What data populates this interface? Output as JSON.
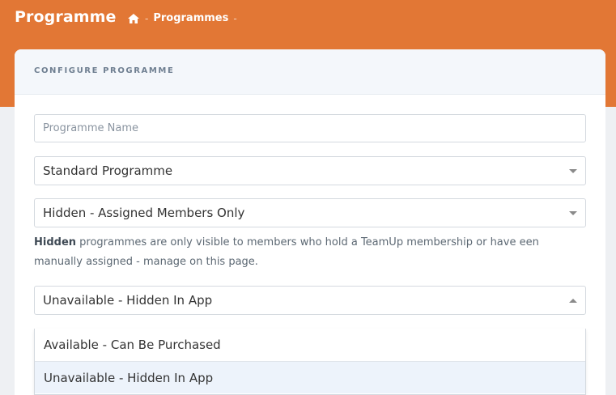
{
  "header": {
    "title": "Programme",
    "breadcrumb": {
      "home_icon": "home-icon",
      "separator": "-",
      "items": [
        "Programmes"
      ]
    }
  },
  "card": {
    "title": "CONFIGURE PROGRAMME",
    "name_field": {
      "placeholder": "Programme Name",
      "value": ""
    },
    "type_select": {
      "value": "Standard Programme"
    },
    "visibility_select": {
      "value": "Hidden - Assigned Members Only"
    },
    "visibility_help": {
      "bold": "Hidden",
      "text": " programmes are only visible to members who hold a TeamUp membership or have een manually assigned - manage on this page."
    },
    "availability_select": {
      "value": "Unavailable - Hidden In App",
      "open": true,
      "options": [
        "Available - Can Be Purchased",
        "Unavailable - Hidden In App"
      ],
      "selected_index": 1
    }
  },
  "colors": {
    "brand": "#e27735",
    "selected_option": "#edf3fb"
  }
}
